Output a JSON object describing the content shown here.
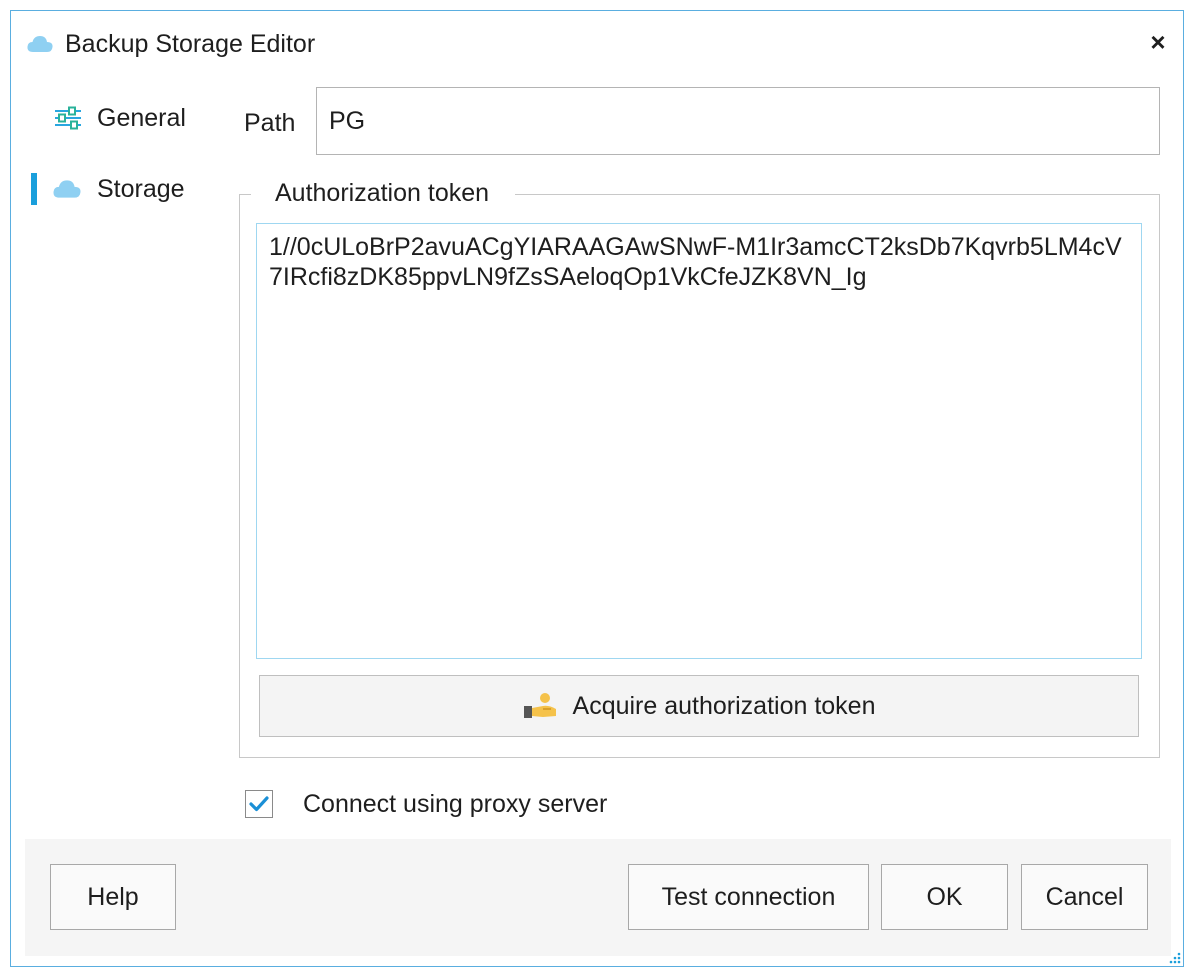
{
  "window": {
    "title": "Backup Storage Editor",
    "close_glyph": "×",
    "icon": "cloud-icon"
  },
  "sidebar": {
    "items": [
      {
        "label": "General",
        "icon": "sliders-icon",
        "selected": false
      },
      {
        "label": "Storage",
        "icon": "cloud-icon",
        "selected": true
      }
    ]
  },
  "path": {
    "label": "Path",
    "value": "PG"
  },
  "authorization": {
    "legend": "Authorization token",
    "token": "1//0cULoBrP2avuACgYIARAAGAwSNwF-M1Ir3amcCT2ksDb7Kqvrb5LM4cV7IRcfi8zDK85ppvLN9fZsSAeloqOp1VkCfeJZK8VN_Ig",
    "acquire_label": "Acquire authorization token",
    "acquire_icon": "handshake-icon"
  },
  "proxy": {
    "label": "Connect using proxy server",
    "checked": true
  },
  "footer": {
    "help_label": "Help",
    "test_label": "Test connection",
    "ok_label": "OK",
    "cancel_label": "Cancel"
  },
  "colors": {
    "accent": "#1a9fdc",
    "window_border": "#5aaee0",
    "footer_bg": "#f5f5f5"
  }
}
